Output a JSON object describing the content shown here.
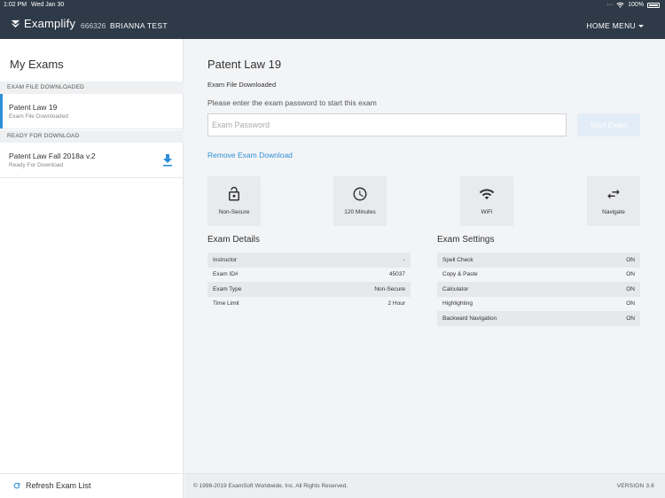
{
  "statusbar": {
    "time": "1:02 PM",
    "date": "Wed Jan 30",
    "battery": "100%"
  },
  "header": {
    "brand": "Examplify",
    "user_id": "666326",
    "user_name": "BRIANNA TEST",
    "home_menu": "HOME MENU",
    "bg_color": "#2e3a48"
  },
  "sidebar": {
    "title": "My Exams",
    "sections": [
      {
        "heading": "EXAM FILE DOWNLOADED",
        "items": [
          {
            "name": "Patent Law 19",
            "status": "Exam File Downloaded",
            "active": true
          }
        ]
      },
      {
        "heading": "READY FOR DOWNLOAD",
        "items": [
          {
            "name": "Patent Law Fall 2018a v.2",
            "status": "Ready For Download",
            "icon": "download-icon"
          }
        ]
      }
    ],
    "refresh_label": "Refresh Exam List"
  },
  "main": {
    "exam_title": "Patent Law 19",
    "file_status": "Exam File Downloaded",
    "password_prompt": "Please enter the exam password to start this exam",
    "password_placeholder": "Exam Password",
    "password_value": "",
    "start_button": "Start Exam",
    "remove_link": "Remove Exam Download",
    "accent_color": "#2d8fd8",
    "tiles": [
      {
        "icon": "lock-open-icon",
        "label": "Non-Secure"
      },
      {
        "icon": "clock-icon",
        "label": "120 Minutes"
      },
      {
        "icon": "wifi-icon",
        "label": "WiFi"
      },
      {
        "icon": "arrows-swap-icon",
        "label": "Navigate"
      }
    ],
    "exam_details": {
      "title": "Exam Details",
      "rows": [
        {
          "label": "Instructor",
          "value": "-"
        },
        {
          "label": "Exam ID#",
          "value": "45037"
        },
        {
          "label": "Exam Type",
          "value": "Non-Secure"
        },
        {
          "label": "Time Limit",
          "value": "2 Hour"
        }
      ]
    },
    "exam_settings": {
      "title": "Exam Settings",
      "rows": [
        {
          "label": "Spell Check",
          "value": "ON"
        },
        {
          "label": "Copy & Paste",
          "value": "ON"
        },
        {
          "label": "Calculator",
          "value": "ON"
        },
        {
          "label": "Highlighting",
          "value": "ON"
        },
        {
          "label": "Backward Navigation",
          "value": "ON"
        }
      ]
    }
  },
  "footer": {
    "copyright": "© 1998-2019 ExamSoft Worldwide, Inc. All Rights Reserved.",
    "version": "VERSION 3.6"
  }
}
